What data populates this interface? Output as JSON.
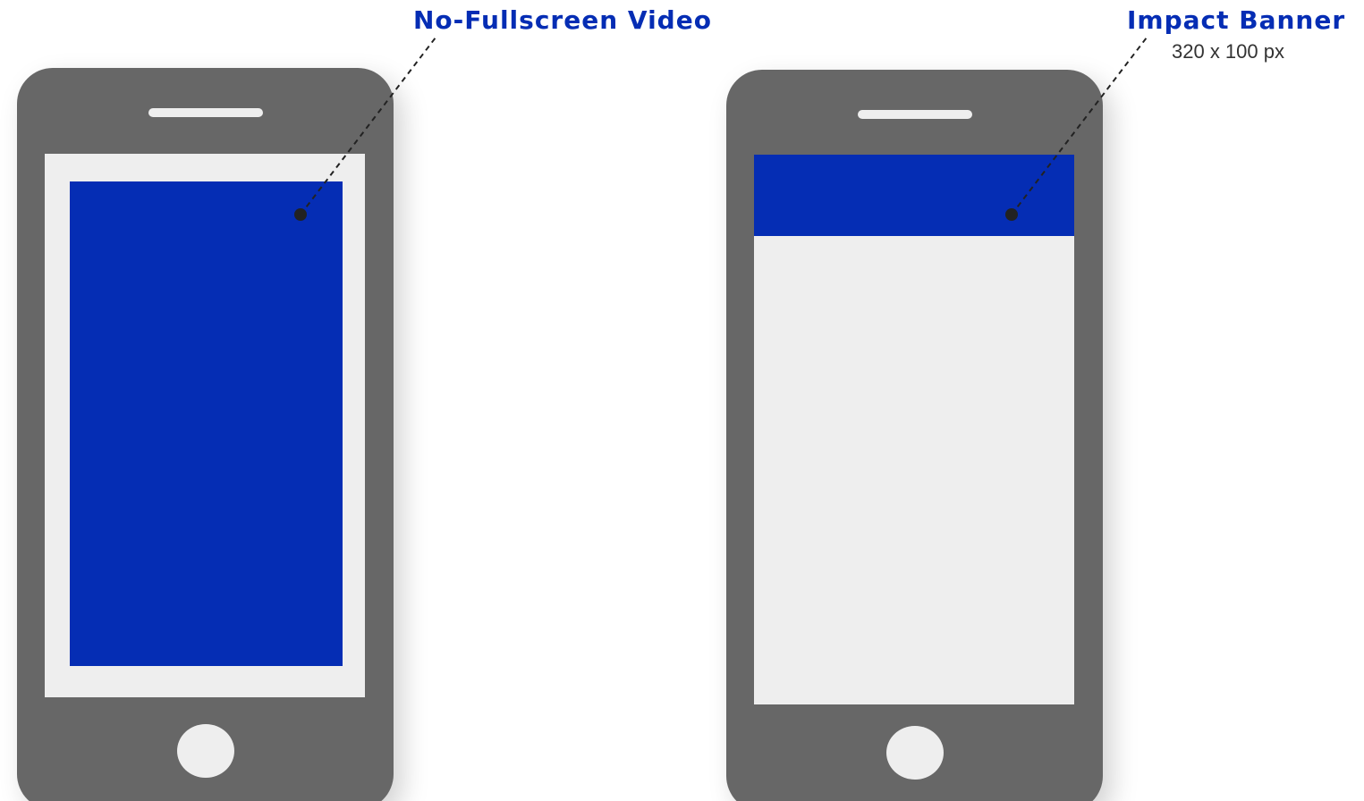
{
  "callouts": {
    "left_title": "No-Fullscreen Video",
    "right_title": "Impact Banner",
    "right_size": "320 x 100 px"
  },
  "colors": {
    "ad_blue": "#052db4",
    "phone_body": "#676767",
    "screen": "#eeeeee",
    "leader_line": "#222222"
  },
  "icons": {
    "left_device": "smartphone-icon",
    "right_device": "smartphone-icon"
  }
}
